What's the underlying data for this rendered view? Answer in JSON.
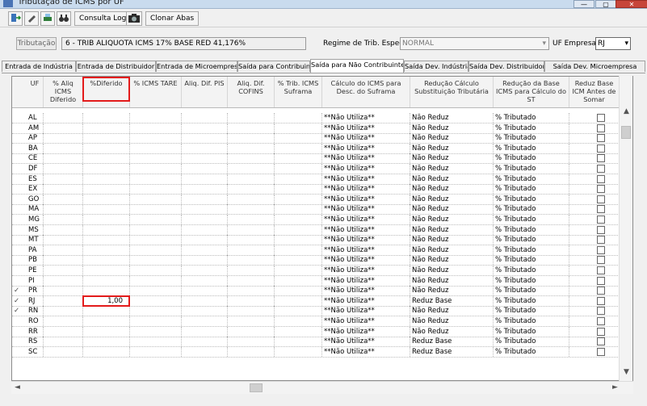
{
  "window": {
    "title": "Tributação de ICMS por UF"
  },
  "toolbar": {
    "consulta_label": "Consulta Log",
    "clonar_label": "Clonar Abas"
  },
  "filters": {
    "tributacao_label": "Tributação",
    "tributacao_value": "6 - TRIB ALIQUOTA ICMS 17% BASE RED 41,176%",
    "regime_label": "Regime de Trib. Especial",
    "regime_value": "NORMAL",
    "uf_empresa_label": "UF Empresa",
    "uf_empresa_value": "RJ"
  },
  "tabs": [
    {
      "label": "Entrada de Indústria"
    },
    {
      "label": "Entrada de Distribuidor"
    },
    {
      "label": "Entrada de Microempresa"
    },
    {
      "label": "Saída para Contribuinte"
    },
    {
      "label": "Saída para Não Contribuinte"
    },
    {
      "label": "Saída Dev. Indústria"
    },
    {
      "label": "Saída Dev. Distribuidor"
    },
    {
      "label": "Saída Dev. Microempresa"
    }
  ],
  "active_tab": 4,
  "columns": [
    {
      "label": "UF"
    },
    {
      "label": "% Aliq ICMS Diferido"
    },
    {
      "label": "%Diferido"
    },
    {
      "label": "% ICMS TARE"
    },
    {
      "label": "Aliq. Dif. PIS"
    },
    {
      "label": "Aliq. Dif. COFINS"
    },
    {
      "label": "% Trib. ICMS Suframa"
    },
    {
      "label": "Cálculo do ICMS para Desc. do Suframa"
    },
    {
      "label": "Redução Cálculo Substituição Tributária"
    },
    {
      "label": "Redução da Base ICMS para Cálculo do ST"
    },
    {
      "label": "Reduz Base ICM Antes de Somar"
    }
  ],
  "rows": [
    {
      "uf": "AL",
      "check": "",
      "diferido": "",
      "suframa": "**Não Utiliza**",
      "reducao_st": "Não Reduz",
      "reducao_base": "% Tributado"
    },
    {
      "uf": "AM",
      "check": "",
      "diferido": "",
      "suframa": "**Não Utiliza**",
      "reducao_st": "Não Reduz",
      "reducao_base": "% Tributado"
    },
    {
      "uf": "AP",
      "check": "",
      "diferido": "",
      "suframa": "**Não Utiliza**",
      "reducao_st": "Não Reduz",
      "reducao_base": "% Tributado"
    },
    {
      "uf": "BA",
      "check": "",
      "diferido": "",
      "suframa": "**Não Utiliza**",
      "reducao_st": "Não Reduz",
      "reducao_base": "% Tributado"
    },
    {
      "uf": "CE",
      "check": "",
      "diferido": "",
      "suframa": "**Não Utiliza**",
      "reducao_st": "Não Reduz",
      "reducao_base": "% Tributado"
    },
    {
      "uf": "DF",
      "check": "",
      "diferido": "",
      "suframa": "**Não Utiliza**",
      "reducao_st": "Não Reduz",
      "reducao_base": "% Tributado"
    },
    {
      "uf": "ES",
      "check": "",
      "diferido": "",
      "suframa": "**Não Utiliza**",
      "reducao_st": "Não Reduz",
      "reducao_base": "% Tributado"
    },
    {
      "uf": "EX",
      "check": "",
      "diferido": "",
      "suframa": "**Não Utiliza**",
      "reducao_st": "Não Reduz",
      "reducao_base": "% Tributado"
    },
    {
      "uf": "GO",
      "check": "",
      "diferido": "",
      "suframa": "**Não Utiliza**",
      "reducao_st": "Não Reduz",
      "reducao_base": "% Tributado"
    },
    {
      "uf": "MA",
      "check": "",
      "diferido": "",
      "suframa": "**Não Utiliza**",
      "reducao_st": "Não Reduz",
      "reducao_base": "% Tributado"
    },
    {
      "uf": "MG",
      "check": "",
      "diferido": "",
      "suframa": "**Não Utiliza**",
      "reducao_st": "Não Reduz",
      "reducao_base": "% Tributado"
    },
    {
      "uf": "MS",
      "check": "",
      "diferido": "",
      "suframa": "**Não Utiliza**",
      "reducao_st": "Não Reduz",
      "reducao_base": "% Tributado"
    },
    {
      "uf": "MT",
      "check": "",
      "diferido": "",
      "suframa": "**Não Utiliza**",
      "reducao_st": "Não Reduz",
      "reducao_base": "% Tributado"
    },
    {
      "uf": "PA",
      "check": "",
      "diferido": "",
      "suframa": "**Não Utiliza**",
      "reducao_st": "Não Reduz",
      "reducao_base": "% Tributado"
    },
    {
      "uf": "PB",
      "check": "",
      "diferido": "",
      "suframa": "**Não Utiliza**",
      "reducao_st": "Não Reduz",
      "reducao_base": "% Tributado"
    },
    {
      "uf": "PE",
      "check": "",
      "diferido": "",
      "suframa": "**Não Utiliza**",
      "reducao_st": "Não Reduz",
      "reducao_base": "% Tributado"
    },
    {
      "uf": "PI",
      "check": "",
      "diferido": "",
      "suframa": "**Não Utiliza**",
      "reducao_st": "Não Reduz",
      "reducao_base": "% Tributado"
    },
    {
      "uf": "PR",
      "check": "✓",
      "diferido": "",
      "suframa": "**Não Utiliza**",
      "reducao_st": "Não Reduz",
      "reducao_base": "% Tributado"
    },
    {
      "uf": "RJ",
      "check": "✓",
      "diferido": "1,00",
      "suframa": "**Não Utiliza**",
      "reducao_st": "Reduz Base",
      "reducao_base": "% Tributado"
    },
    {
      "uf": "RN",
      "check": "✓",
      "diferido": "",
      "suframa": "**Não Utiliza**",
      "reducao_st": "Não Reduz",
      "reducao_base": "% Tributado"
    },
    {
      "uf": "RO",
      "check": "",
      "diferido": "",
      "suframa": "**Não Utiliza**",
      "reducao_st": "Não Reduz",
      "reducao_base": "% Tributado"
    },
    {
      "uf": "RR",
      "check": "",
      "diferido": "",
      "suframa": "**Não Utiliza**",
      "reducao_st": "Não Reduz",
      "reducao_base": "% Tributado"
    },
    {
      "uf": "RS",
      "check": "",
      "diferido": "",
      "suframa": "**Não Utiliza**",
      "reducao_st": "Reduz Base",
      "reducao_base": "% Tributado"
    },
    {
      "uf": "SC",
      "check": "",
      "diferido": "",
      "suframa": "**Não Utiliza**",
      "reducao_st": "Reduz Base",
      "reducao_base": "% Tributado"
    }
  ]
}
